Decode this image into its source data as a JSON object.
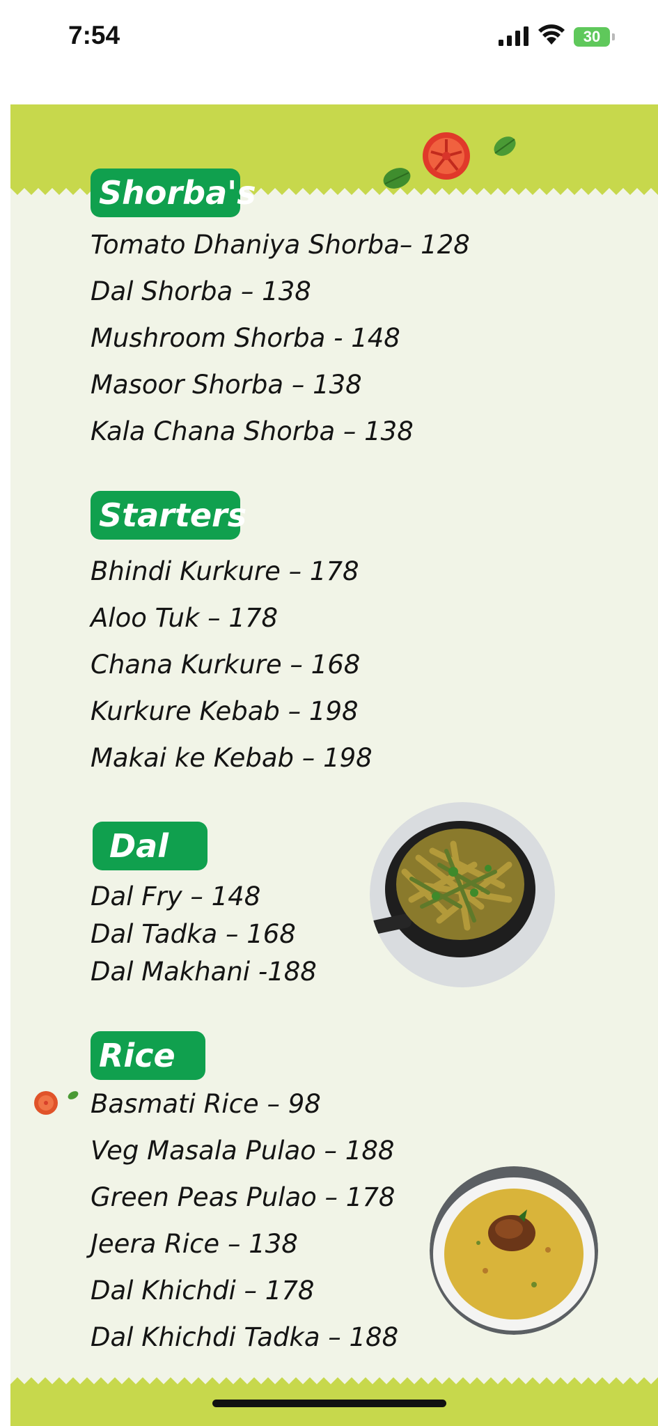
{
  "status_bar": {
    "time": "7:54",
    "battery": "30"
  },
  "sections": [
    {
      "title": "Shorba's",
      "items": [
        "Tomato Dhaniya Shorba– 128",
        "Dal Shorba – 138",
        "Mushroom Shorba - 148",
        "Masoor Shorba – 138",
        "Kala Chana Shorba – 138"
      ]
    },
    {
      "title": "Starters",
      "items": [
        "Bhindi Kurkure – 178",
        "Aloo Tuk – 178",
        "Chana Kurkure – 168",
        "Kurkure Kebab – 198",
        "Makai ke Kebab – 198"
      ]
    },
    {
      "title": "Dal",
      "items": [
        "Dal Fry – 148",
        "Dal Tadka – 168",
        "Dal Makhani -188"
      ]
    },
    {
      "title": "Rice",
      "items": [
        "Basmati Rice – 98",
        "Veg Masala Pulao – 188",
        "Green Peas Pulao – 178",
        "Jeera Rice – 138",
        "Dal Khichdi – 178",
        "Dal Khichdi Tadka – 188"
      ]
    }
  ],
  "colors": {
    "band": "#c7d84c",
    "background": "#f1f4e7",
    "badge": "#10a04e",
    "text": "#141414"
  }
}
